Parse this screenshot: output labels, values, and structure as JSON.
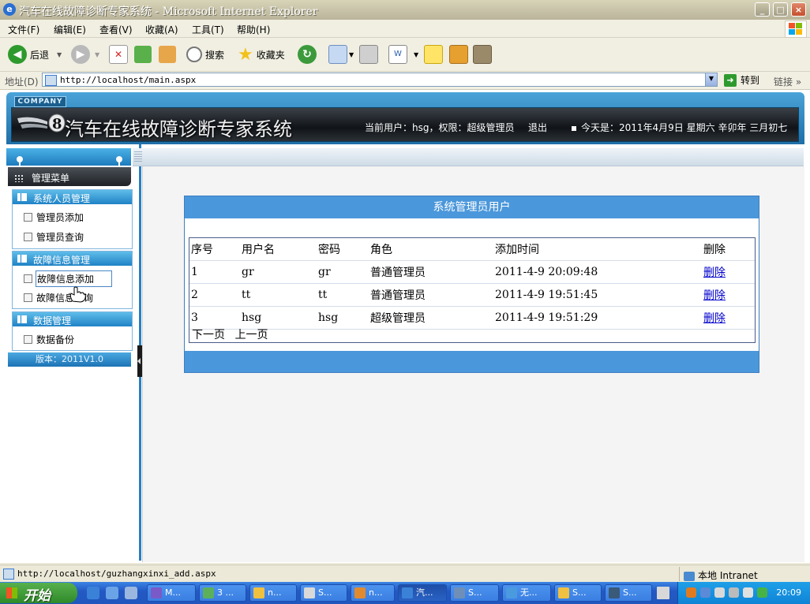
{
  "window": {
    "title": "汽车在线故障诊断专家系统 - Microsoft Internet Explorer",
    "buttons": {
      "minimize": "_",
      "maximize": "□",
      "close": "×"
    }
  },
  "menubar": [
    "文件(F)",
    "编辑(E)",
    "查看(V)",
    "收藏(A)",
    "工具(T)",
    "帮助(H)"
  ],
  "toolbar": {
    "back": "后退",
    "search": "搜索",
    "favorites": "收藏夹"
  },
  "address": {
    "label": "地址(D)",
    "url": "http://localhost/main.aspx",
    "go": "转到",
    "links": "链接"
  },
  "site": {
    "company": "COMPANY",
    "title": "汽车在线故障诊断专家系统",
    "user_info": "当前用户：hsg，权限：超级管理员",
    "logout": "退出",
    "date": "今天是：2011年4月9日 星期六 辛卯年 三月初七"
  },
  "sidebar": {
    "menu_title": "管理菜单",
    "sections": [
      {
        "title": "系统人员管理",
        "items": [
          "管理员添加",
          "管理员查询"
        ]
      },
      {
        "title": "故障信息管理",
        "items": [
          "故障信息添加",
          "故障信息查询"
        ]
      },
      {
        "title": "数据管理",
        "items": [
          "数据备份"
        ]
      }
    ],
    "version": "版本：2011V1.0"
  },
  "panel": {
    "title": "系统管理员用户",
    "columns": [
      "序号",
      "用户名",
      "密码",
      "角色",
      "添加时间",
      "删除"
    ],
    "rows": [
      [
        "1",
        "gr",
        "gr",
        "普通管理员",
        "2011-4-9 20:09:48",
        "删除"
      ],
      [
        "2",
        "tt",
        "tt",
        "普通管理员",
        "2011-4-9 19:51:45",
        "删除"
      ],
      [
        "3",
        "hsg",
        "hsg",
        "超级管理员",
        "2011-4-9 19:51:29",
        "删除"
      ]
    ],
    "pager": {
      "next": "下一页",
      "prev": "上一页"
    }
  },
  "statusbar": {
    "url": "http://localhost/guzhangxinxi_add.aspx",
    "zone": "本地 Intranet"
  },
  "taskbar": {
    "start": "开始",
    "tasks": [
      "M...",
      "3 ...",
      "n...",
      "S...",
      "n...",
      "汽...",
      "S...",
      "无...",
      "S...",
      "S..."
    ],
    "clock": "20:09"
  },
  "colors": {
    "accent": "#4b97db",
    "header_dark": "#101418",
    "link": "#0000cc"
  }
}
